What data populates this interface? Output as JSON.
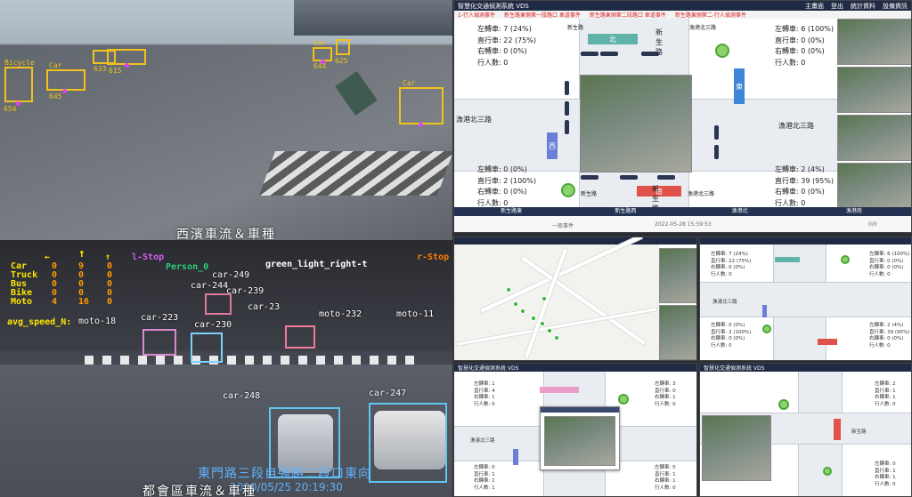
{
  "cam_west": {
    "caption": "西濱車流＆車種",
    "detections": [
      {
        "label": "Bicycle",
        "id": "654",
        "color": "#f2c21b"
      },
      {
        "label": "Car",
        "id": "645",
        "color": "#f2c21b"
      },
      {
        "label": "Car",
        "id": "633",
        "color": "#f2c21b"
      },
      {
        "label": "Car",
        "id": "615",
        "color": "#f2c21b"
      },
      {
        "label": "Car",
        "id": "644",
        "color": "#f2c21b"
      },
      {
        "label": "Car",
        "id": "625",
        "color": "#f2c21b"
      },
      {
        "label": "Car",
        "id": "",
        "color": "#f2c21b"
      }
    ]
  },
  "cam_east": {
    "caption": "都會區車流＆車種",
    "location_overlay": "東門路三段自強路二段口東向",
    "timestamp": "2020/05/25 20:19:30",
    "counter_headers": [
      "←",
      "↑",
      "↑"
    ],
    "counter_rows": [
      {
        "label": "Car",
        "left": "0",
        "straight": "9",
        "right": "0"
      },
      {
        "label": "Truck",
        "left": "0",
        "straight": "0",
        "right": "0"
      },
      {
        "label": "Bus",
        "left": "0",
        "straight": "0",
        "right": "0"
      },
      {
        "label": "Bike",
        "left": "0",
        "straight": "0",
        "right": "0"
      },
      {
        "label": "Moto",
        "left": "4",
        "straight": "16",
        "right": "0"
      }
    ],
    "avg_speed_label": "avg_speed_N:",
    "top_labels": {
      "l_stop": "l-Stop",
      "person": "Person_0",
      "green_right": "green_light_right-t",
      "r_stop": "r-Stop"
    },
    "detections": [
      {
        "label": "car-249"
      },
      {
        "label": "car-244"
      },
      {
        "label": "car-239"
      },
      {
        "label": "car-223"
      },
      {
        "label": "car-230"
      },
      {
        "label": "car-23"
      },
      {
        "label": "moto-232"
      },
      {
        "label": "moto-11"
      },
      {
        "label": "moto-18"
      },
      {
        "label": "car-248"
      },
      {
        "label": "car-247"
      }
    ]
  },
  "vds_main": {
    "title": "智慧化交通偵測系統 VDS",
    "header_links": [
      "主畫面",
      "登出",
      "統計資料",
      "設備資訊"
    ],
    "notices": [
      "1-行人偵測事件",
      "新生路東側第一段路口 車道事件",
      "新生路東側第二段路口 車道事件",
      "新生路東側第二-行人偵測事件"
    ],
    "ne": {
      "left": "左轉車: 6 (100%)",
      "straight": "直行車: 0 (0%)",
      "right": "右轉車: 0 (0%)",
      "ped": "行人數: 0"
    },
    "nw": {
      "left": "左轉車: 7 (24%)",
      "straight": "直行車: 22 (75%)",
      "right": "右轉車: 0 (0%)",
      "ped": "行人數: 0"
    },
    "sw": {
      "left": "左轉車: 0 (0%)",
      "straight": "直行車: 2 (100%)",
      "right": "右轉車: 0 (0%)",
      "ped": "行人數: 0"
    },
    "se": {
      "left": "左轉車: 2 (4%)",
      "straight": "直行車: 39 (95%)",
      "right": "右轉車: 0 (0%)",
      "ped": "行人數: 0"
    },
    "road_west": "漁港北三路",
    "road_east": "漁港北三路",
    "road_north": "新生路",
    "road_south": "新生路",
    "dir_north": "北",
    "dir_south": "南",
    "dir_west": "西",
    "dir_east": "東",
    "intersection_labels": [
      "新生路",
      "漁港北三路",
      "新生路",
      "漁港北三路"
    ],
    "footer": [
      "新生路東",
      "新生路西",
      "漁港北",
      "漁港南"
    ],
    "event_label": "一般事件",
    "timestamp": "2022-05-28 15:59:53",
    "counter": "0/0"
  },
  "vds_mini_a": {
    "nw": [
      "左轉車: 7 (24%)",
      "直行車: 22 (75%)",
      "右轉車: 0 (0%)",
      "行人數: 0"
    ],
    "ne": [
      "左轉車: 6 (100%)",
      "直行車: 0 (0%)",
      "右轉車: 0 (0%)",
      "行人數: 0"
    ],
    "sw": [
      "左轉車: 0 (0%)",
      "直行車: 2 (100%)",
      "右轉車: 0 (0%)",
      "行人數: 0"
    ],
    "se": [
      "左轉車: 2 (4%)",
      "直行車: 39 (95%)",
      "右轉車: 0 (0%)",
      "行人數: 0"
    ],
    "road": "漁港北三路"
  },
  "vds_mini_b": {
    "title": "智慧化交通偵測系統 VDS",
    "left": [
      "左轉車: 1",
      "直行車: 4",
      "右轉車: 1",
      "行人數: 0"
    ],
    "right": [
      "左轉車: 3",
      "直行車: 0",
      "右轉車: 1",
      "行人數: 0"
    ],
    "left2": [
      "左轉車: 0",
      "直行車: 1",
      "右轉車: 1",
      "行人數: 1"
    ],
    "right2": [
      "左轉車: 0",
      "直行車: 1",
      "右轉車: 1",
      "行人數: 0"
    ],
    "road": "漁港北三路"
  },
  "vds_mini_c": {
    "title": "智慧化交通偵測系統 VDS",
    "right": [
      "左轉車: 2",
      "直行車: 1",
      "右轉車: 1",
      "行人數: 0"
    ],
    "right2": [
      "左轉車: 0",
      "直行車: 1",
      "右轉車: 1",
      "行人數: 0"
    ],
    "road": "新生路"
  },
  "colors": {
    "header": "#1f2a44",
    "north_dir": "#5fb3a8",
    "south_dir": "#e0524c",
    "west_dir": "#6b7fd6",
    "east_dir": "#3d86d8",
    "marker": "#8bd36b"
  }
}
